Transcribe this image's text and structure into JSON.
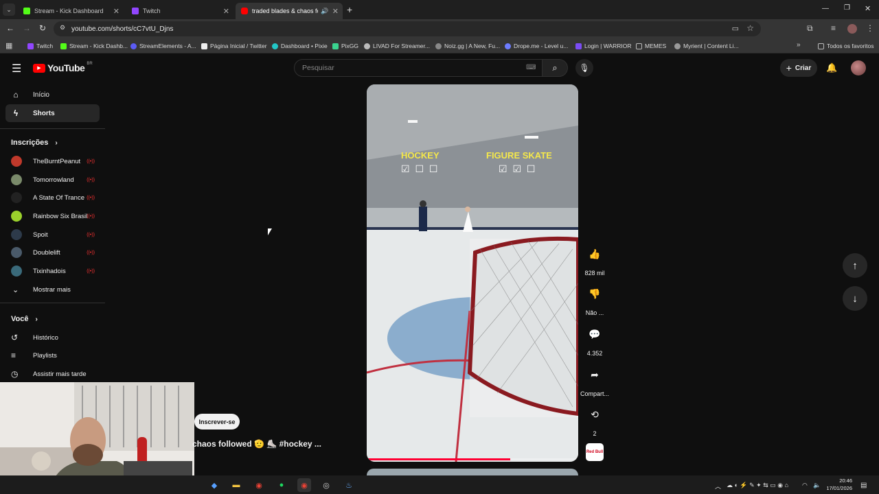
{
  "browser": {
    "tabs": [
      {
        "title": "Stream - Kick Dashboard",
        "favicon_color": "#53fc18"
      },
      {
        "title": "Twitch",
        "favicon_color": "#9146ff"
      },
      {
        "title": "traded blades & chaos follo",
        "favicon_color": "#ff0000"
      }
    ],
    "new_tab_icon": "plus-icon",
    "url": "youtube.com/shorts/cC7vtU_Djns",
    "bookmarks": [
      {
        "label": "Twitch",
        "color": "#9146ff"
      },
      {
        "label": "Stream - Kick Dashb...",
        "color": "#53fc18"
      },
      {
        "label": "StreamElements - A...",
        "color": "#5b5bf5"
      },
      {
        "label": "Página Inicial / Twitter",
        "color": "#eeeeee"
      },
      {
        "label": "Dashboard • Pixie",
        "color": "#22c7c7"
      },
      {
        "label": "PixGG",
        "color": "#3ad38f"
      },
      {
        "label": "LIVAD For Streamer...",
        "color": "#bbbbbb"
      },
      {
        "label": "Noiz.gg | A New, Fu...",
        "color": "#888888"
      },
      {
        "label": "Drope.me - Level u...",
        "color": "#6d7cff"
      },
      {
        "label": "Login | WARRIOR",
        "color": "#7b4cf5"
      },
      {
        "label": "MEMES",
        "color": "#bbbbbb"
      },
      {
        "label": "Myrient | Content Li...",
        "color": "#999999"
      }
    ],
    "all_favorites": "Todos os favoritos"
  },
  "youtube": {
    "logo_text": "YouTube",
    "region": "BR",
    "search_placeholder": "Pesquisar",
    "create_label": "Criar"
  },
  "sidebar": {
    "home": "Início",
    "shorts": "Shorts",
    "subscriptions_title": "Inscrições",
    "channels": [
      {
        "name": "TheBurntPeanut",
        "color": "#c0392b"
      },
      {
        "name": "Tomorrowland",
        "color": "#7a8a6a"
      },
      {
        "name": "A State Of Trance",
        "color": "#222222"
      },
      {
        "name": "Rainbow Six Brasil",
        "color": "#9bd12c"
      },
      {
        "name": "Spoit",
        "color": "#2d3a4a"
      },
      {
        "name": "Doublelift",
        "color": "#4a5a6a"
      },
      {
        "name": "Tixinhadois",
        "color": "#3a6a7a"
      }
    ],
    "show_more": "Mostrar mais",
    "you_title": "Você",
    "history": "Histórico",
    "playlists": "Playlists",
    "watch_later": "Assistir mais tarde"
  },
  "short": {
    "overlay_left": "HOCKEY",
    "overlay_right": "FIGURE SKATE",
    "left_checks": "☑ ☐ ☐",
    "right_checks": "☑ ☑ ☐",
    "subscribe": "Inscrever-se",
    "title": "chaos followed 🫡 ⛸️ #hockey ...",
    "progress": 0.68
  },
  "actions": {
    "likes": "828 mil",
    "dislike": "Não ...",
    "comments": "4.352",
    "share": "Compart...",
    "remix": "2",
    "sound_label": "Red Bull"
  },
  "taskbar": {
    "time": "20:46",
    "date": "17/01/2026"
  }
}
